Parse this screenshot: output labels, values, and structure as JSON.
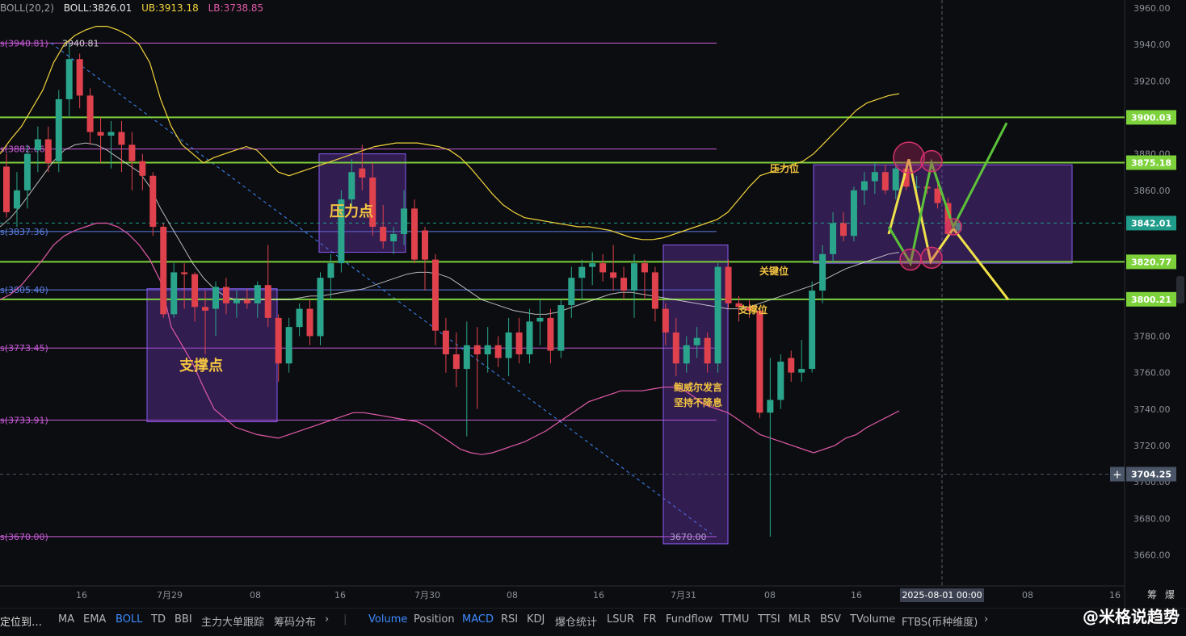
{
  "indicator_legend": {
    "name": "BOLL(20,2)",
    "boll": "BOLL:3826.01",
    "ub": "UB:3913.18",
    "lb": "LB:3738.85",
    "colors": {
      "boll": "#e6e6e6",
      "ub": "#f0d33c",
      "lb": "#e05aa8"
    }
  },
  "chart_data": {
    "type": "candlestick",
    "title": "",
    "x_axis_labels": [
      "16",
      "7月29",
      "08",
      "16",
      "7月30",
      "08",
      "16",
      "7月31",
      "08",
      "16",
      "2025-08-01 00:00",
      "08",
      "16"
    ],
    "crosshair_x_label": "2025-08-01 00:00",
    "y_axis": {
      "min": 3655,
      "max": 3965,
      "ticks": [
        3660,
        3680,
        3700,
        3720,
        3740,
        3760,
        3780,
        3800,
        3820,
        3840,
        3860,
        3880,
        3900,
        3920,
        3940,
        3960
      ]
    },
    "price_lines": [
      {
        "value": 3900.03,
        "label": "3900.03",
        "color": "#7dd13b"
      },
      {
        "value": 3875.18,
        "label": "3875.18",
        "color": "#7dd13b"
      },
      {
        "value": 3842.01,
        "label": "3842.01",
        "color": "#1f9c8a",
        "dashed": true
      },
      {
        "value": 3820.77,
        "label": "3820.77",
        "color": "#7dd13b"
      },
      {
        "value": 3800.21,
        "label": "3800.21",
        "color": "#7dd13b"
      },
      {
        "value": 3704.25,
        "label": "3704.25",
        "color": "#4a5568",
        "dashed": true
      }
    ],
    "horizontal_levels": [
      {
        "value": 3940.81,
        "label": "s(3940.81)",
        "color": "#c85bd9"
      },
      {
        "value": 3882.66,
        "label": "s(3882.66)",
        "color": "#c85bd9"
      },
      {
        "value": 3837.36,
        "label": "s(3837.36)",
        "color": "#5b7ee5"
      },
      {
        "value": 3805.4,
        "label": "s(3805.40)",
        "color": "#5b7ee5"
      },
      {
        "value": 3773.45,
        "label": "s(3773.45)",
        "color": "#c85bd9"
      },
      {
        "value": 3733.91,
        "label": "s(3733.91)",
        "color": "#c85bd9"
      },
      {
        "value": 3670.0,
        "label": "s(3670.00)",
        "color": "#c85bd9"
      }
    ],
    "level_tags": [
      "3940.81",
      "3670.00"
    ],
    "annotations": [
      {
        "text": "压力点",
        "color": "#f5c542"
      },
      {
        "text": "支撑点",
        "color": "#f5c542"
      },
      {
        "text": "压力位",
        "color": "#f5c542"
      },
      {
        "text": "关键位",
        "color": "#f5c542"
      },
      {
        "text": "支撑位",
        "color": "#f5c542"
      },
      {
        "text": "鲍威尔发言",
        "color": "#f5c542"
      },
      {
        "text": "坚持不降息",
        "color": "#f5c542"
      }
    ],
    "candles": [
      {
        "o": 3873,
        "h": 3880,
        "l": 3845,
        "c": 3848
      },
      {
        "o": 3850,
        "h": 3870,
        "l": 3840,
        "c": 3860
      },
      {
        "o": 3860,
        "h": 3885,
        "l": 3850,
        "c": 3880
      },
      {
        "o": 3882,
        "h": 3895,
        "l": 3870,
        "c": 3888
      },
      {
        "o": 3888,
        "h": 3895,
        "l": 3870,
        "c": 3875
      },
      {
        "o": 3876,
        "h": 3915,
        "l": 3870,
        "c": 3910
      },
      {
        "o": 3910,
        "h": 3941,
        "l": 3900,
        "c": 3932
      },
      {
        "o": 3932,
        "h": 3935,
        "l": 3905,
        "c": 3912
      },
      {
        "o": 3912,
        "h": 3916,
        "l": 3885,
        "c": 3892
      },
      {
        "o": 3892,
        "h": 3900,
        "l": 3875,
        "c": 3890
      },
      {
        "o": 3890,
        "h": 3898,
        "l": 3872,
        "c": 3892
      },
      {
        "o": 3892,
        "h": 3898,
        "l": 3870,
        "c": 3885
      },
      {
        "o": 3885,
        "h": 3892,
        "l": 3860,
        "c": 3876
      },
      {
        "o": 3876,
        "h": 3880,
        "l": 3860,
        "c": 3868
      },
      {
        "o": 3868,
        "h": 3870,
        "l": 3835,
        "c": 3840
      },
      {
        "o": 3840,
        "h": 3842,
        "l": 3790,
        "c": 3792
      },
      {
        "o": 3792,
        "h": 3820,
        "l": 3790,
        "c": 3815
      },
      {
        "o": 3815,
        "h": 3820,
        "l": 3795,
        "c": 3814
      },
      {
        "o": 3814,
        "h": 3815,
        "l": 3788,
        "c": 3796
      },
      {
        "o": 3796,
        "h": 3805,
        "l": 3770,
        "c": 3794
      },
      {
        "o": 3795,
        "h": 3810,
        "l": 3780,
        "c": 3807
      },
      {
        "o": 3807,
        "h": 3812,
        "l": 3792,
        "c": 3798
      },
      {
        "o": 3798,
        "h": 3805,
        "l": 3790,
        "c": 3800
      },
      {
        "o": 3800,
        "h": 3806,
        "l": 3795,
        "c": 3798
      },
      {
        "o": 3798,
        "h": 3810,
        "l": 3790,
        "c": 3808
      },
      {
        "o": 3808,
        "h": 3830,
        "l": 3785,
        "c": 3790
      },
      {
        "o": 3790,
        "h": 3792,
        "l": 3755,
        "c": 3765
      },
      {
        "o": 3765,
        "h": 3790,
        "l": 3760,
        "c": 3785
      },
      {
        "o": 3785,
        "h": 3798,
        "l": 3780,
        "c": 3795
      },
      {
        "o": 3795,
        "h": 3800,
        "l": 3775,
        "c": 3780
      },
      {
        "o": 3780,
        "h": 3815,
        "l": 3775,
        "c": 3812
      },
      {
        "o": 3812,
        "h": 3825,
        "l": 3800,
        "c": 3820
      },
      {
        "o": 3820,
        "h": 3860,
        "l": 3815,
        "c": 3855
      },
      {
        "o": 3855,
        "h": 3877,
        "l": 3850,
        "c": 3870
      },
      {
        "o": 3872,
        "h": 3885,
        "l": 3860,
        "c": 3867
      },
      {
        "o": 3867,
        "h": 3875,
        "l": 3835,
        "c": 3840
      },
      {
        "o": 3840,
        "h": 3852,
        "l": 3828,
        "c": 3832
      },
      {
        "o": 3832,
        "h": 3840,
        "l": 3825,
        "c": 3836
      },
      {
        "o": 3836,
        "h": 3860,
        "l": 3830,
        "c": 3850
      },
      {
        "o": 3850,
        "h": 3855,
        "l": 3820,
        "c": 3822
      },
      {
        "o": 3838,
        "h": 3840,
        "l": 3805,
        "c": 3822
      },
      {
        "o": 3822,
        "h": 3825,
        "l": 3775,
        "c": 3783
      },
      {
        "o": 3783,
        "h": 3790,
        "l": 3760,
        "c": 3770
      },
      {
        "o": 3770,
        "h": 3782,
        "l": 3752,
        "c": 3762
      },
      {
        "o": 3762,
        "h": 3788,
        "l": 3725,
        "c": 3775
      },
      {
        "o": 3775,
        "h": 3785,
        "l": 3740,
        "c": 3770
      },
      {
        "o": 3770,
        "h": 3785,
        "l": 3760,
        "c": 3775
      },
      {
        "o": 3775,
        "h": 3780,
        "l": 3763,
        "c": 3768
      },
      {
        "o": 3768,
        "h": 3790,
        "l": 3758,
        "c": 3782
      },
      {
        "o": 3782,
        "h": 3790,
        "l": 3765,
        "c": 3770
      },
      {
        "o": 3770,
        "h": 3795,
        "l": 3765,
        "c": 3788
      },
      {
        "o": 3788,
        "h": 3800,
        "l": 3775,
        "c": 3790
      },
      {
        "o": 3790,
        "h": 3795,
        "l": 3765,
        "c": 3772
      },
      {
        "o": 3772,
        "h": 3800,
        "l": 3768,
        "c": 3797
      },
      {
        "o": 3797,
        "h": 3818,
        "l": 3790,
        "c": 3812
      },
      {
        "o": 3812,
        "h": 3822,
        "l": 3800,
        "c": 3818
      },
      {
        "o": 3818,
        "h": 3826,
        "l": 3808,
        "c": 3820
      },
      {
        "o": 3820,
        "h": 3825,
        "l": 3810,
        "c": 3815
      },
      {
        "o": 3815,
        "h": 3830,
        "l": 3805,
        "c": 3812
      },
      {
        "o": 3812,
        "h": 3818,
        "l": 3800,
        "c": 3805
      },
      {
        "o": 3805,
        "h": 3825,
        "l": 3790,
        "c": 3820
      },
      {
        "o": 3820,
        "h": 3822,
        "l": 3800,
        "c": 3815
      },
      {
        "o": 3815,
        "h": 3818,
        "l": 3788,
        "c": 3795
      },
      {
        "o": 3795,
        "h": 3798,
        "l": 3775,
        "c": 3782
      },
      {
        "o": 3782,
        "h": 3790,
        "l": 3758,
        "c": 3765
      },
      {
        "o": 3765,
        "h": 3780,
        "l": 3760,
        "c": 3775
      },
      {
        "o": 3775,
        "h": 3785,
        "l": 3768,
        "c": 3779
      },
      {
        "o": 3779,
        "h": 3782,
        "l": 3760,
        "c": 3765
      },
      {
        "o": 3765,
        "h": 3820,
        "l": 3760,
        "c": 3818
      },
      {
        "o": 3818,
        "h": 3822,
        "l": 3795,
        "c": 3798
      },
      {
        "o": 3798,
        "h": 3802,
        "l": 3788,
        "c": 3796
      },
      {
        "o": 3796,
        "h": 3800,
        "l": 3790,
        "c": 3794
      },
      {
        "o": 3794,
        "h": 3796,
        "l": 3735,
        "c": 3738
      },
      {
        "o": 3738,
        "h": 3768,
        "l": 3670,
        "c": 3745
      },
      {
        "o": 3745,
        "h": 3770,
        "l": 3740,
        "c": 3766
      },
      {
        "o": 3768,
        "h": 3772,
        "l": 3755,
        "c": 3760
      },
      {
        "o": 3760,
        "h": 3778,
        "l": 3755,
        "c": 3762
      },
      {
        "o": 3762,
        "h": 3810,
        "l": 3760,
        "c": 3805
      },
      {
        "o": 3805,
        "h": 3830,
        "l": 3798,
        "c": 3825
      },
      {
        "o": 3825,
        "h": 3848,
        "l": 3820,
        "c": 3842
      },
      {
        "o": 3842,
        "h": 3848,
        "l": 3832,
        "c": 3835
      },
      {
        "o": 3835,
        "h": 3862,
        "l": 3832,
        "c": 3860
      },
      {
        "o": 3860,
        "h": 3870,
        "l": 3852,
        "c": 3865
      },
      {
        "o": 3865,
        "h": 3875,
        "l": 3858,
        "c": 3870
      },
      {
        "o": 3870,
        "h": 3874,
        "l": 3858,
        "c": 3860
      },
      {
        "o": 3860,
        "h": 3875,
        "l": 3855,
        "c": 3872
      },
      {
        "o": 3872,
        "h": 3876,
        "l": 3860,
        "c": 3862
      },
      {
        "o": 3862,
        "h": 3868,
        "l": 3858,
        "c": 3862
      },
      {
        "o": 3862,
        "h": 3866,
        "l": 3858,
        "c": 3861
      },
      {
        "o": 3861,
        "h": 3865,
        "l": 3850,
        "c": 3853
      },
      {
        "o": 3853,
        "h": 3856,
        "l": 3835,
        "c": 3836
      },
      {
        "o": 3838,
        "h": 3843,
        "l": 3836,
        "c": 3842
      }
    ],
    "bands": {
      "ub": [
        3880,
        3888,
        3895,
        3905,
        3915,
        3930,
        3940,
        3945,
        3948,
        3950,
        3950,
        3948,
        3945,
        3940,
        3930,
        3910,
        3895,
        3885,
        3880,
        3875,
        3878,
        3880,
        3882,
        3884,
        3882,
        3876,
        3870,
        3868,
        3870,
        3872,
        3874,
        3876,
        3878,
        3880,
        3882,
        3884,
        3885,
        3886,
        3886,
        3886,
        3885,
        3884,
        3882,
        3878,
        3872,
        3865,
        3858,
        3852,
        3848,
        3845,
        3844,
        3843,
        3842,
        3841,
        3840,
        3840,
        3839,
        3838,
        3836,
        3834,
        3833,
        3833,
        3834,
        3836,
        3838,
        3840,
        3842,
        3844,
        3848,
        3855,
        3862,
        3868,
        3870,
        3872,
        3874,
        3876,
        3880,
        3886,
        3892,
        3898,
        3904,
        3908,
        3910,
        3912,
        3913
      ],
      "mid": [
        3840,
        3845,
        3852,
        3860,
        3868,
        3876,
        3882,
        3885,
        3886,
        3885,
        3882,
        3878,
        3874,
        3870,
        3862,
        3850,
        3840,
        3830,
        3820,
        3812,
        3806,
        3802,
        3800,
        3800,
        3800,
        3800,
        3800,
        3800,
        3801,
        3802,
        3802,
        3803,
        3804,
        3805,
        3806,
        3808,
        3810,
        3812,
        3814,
        3815,
        3815,
        3814,
        3812,
        3808,
        3804,
        3800,
        3798,
        3796,
        3794,
        3793,
        3792,
        3792,
        3793,
        3795,
        3797,
        3799,
        3801,
        3803,
        3804,
        3804,
        3803,
        3802,
        3801,
        3800,
        3799,
        3798,
        3797,
        3796,
        3795,
        3795,
        3796,
        3798,
        3800,
        3802,
        3804,
        3806,
        3808,
        3811,
        3814,
        3817,
        3819,
        3821,
        3823,
        3825,
        3826
      ],
      "lb": [
        3800,
        3803,
        3808,
        3815,
        3822,
        3830,
        3835,
        3838,
        3840,
        3842,
        3842,
        3840,
        3836,
        3830,
        3822,
        3810,
        3785,
        3775,
        3765,
        3752,
        3740,
        3735,
        3730,
        3728,
        3726,
        3725,
        3724,
        3726,
        3728,
        3730,
        3732,
        3734,
        3736,
        3738,
        3738,
        3737,
        3736,
        3735,
        3734,
        3733,
        3730,
        3726,
        3722,
        3718,
        3716,
        3715,
        3716,
        3718,
        3720,
        3722,
        3725,
        3728,
        3732,
        3736,
        3740,
        3744,
        3746,
        3748,
        3750,
        3750,
        3750,
        3751,
        3752,
        3752,
        3750,
        3746,
        3742,
        3740,
        3738,
        3734,
        3730,
        3726,
        3724,
        3722,
        3720,
        3718,
        3716,
        3718,
        3720,
        3724,
        3726,
        3730,
        3733,
        3736,
        3739
      ]
    },
    "grid": false,
    "legend_position": "top-left"
  },
  "bottom_toolbar": {
    "left_label": "定位到…",
    "indicators": [
      "MA",
      "EMA",
      "BOLL",
      "TD",
      "BBI",
      "主力大单跟踪",
      "筹码分布"
    ],
    "oscillators": [
      "Volume",
      "Position",
      "MACD",
      "RSI",
      "KDJ",
      "爆仓统计",
      "LSUR",
      "FR",
      "Fundflow",
      "TTMU",
      "TTSI",
      "MLR",
      "BSV",
      "TVolume",
      "FTBS(币种维度)"
    ],
    "active": [
      "BOLL",
      "Volume",
      "MACD"
    ]
  },
  "right_top_labels": [
    "筹",
    "爆"
  ],
  "watermark": "@米格说趋势",
  "colors": {
    "up": "#2aa58b",
    "down": "#e0424d",
    "accent": "#3d8bff",
    "background": "#0c0d10"
  }
}
